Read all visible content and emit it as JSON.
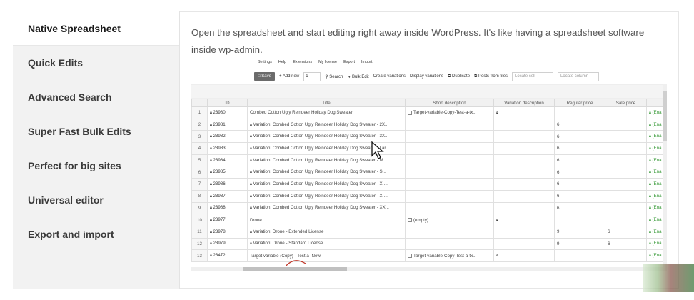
{
  "tabs": [
    {
      "label": "Native Spreadsheet",
      "active": true
    },
    {
      "label": "Quick Edits",
      "active": false
    },
    {
      "label": "Advanced Search",
      "active": false
    },
    {
      "label": "Super Fast Bulk Edits",
      "active": false
    },
    {
      "label": "Perfect for big sites",
      "active": false
    },
    {
      "label": "Universal editor",
      "active": false
    },
    {
      "label": "Export and import",
      "active": false
    }
  ],
  "intro": "Open the spreadsheet and start editing right away inside WordPress. It's like having a spreadsheet software inside wp-admin.",
  "app": {
    "menu": [
      "Settings",
      "Help",
      "Extensions",
      "My license",
      "Export",
      "Import"
    ],
    "toolbar": {
      "save": "Save",
      "add_new": "+ Add new",
      "add_count": "1",
      "search": "Search",
      "bulk_edit": "Bulk Edit",
      "create_variations": "Create variations",
      "display_variations": "Display variations",
      "duplicate": "Duplicate",
      "posts_from_files": "Posts from files",
      "locate_cell": "Locate cell",
      "locate_column": "Locate column"
    },
    "columns": [
      "",
      "ID",
      "Title",
      "Short description",
      "Variation description",
      "Regular price",
      "Sale price",
      ""
    ],
    "rows": [
      {
        "n": "1",
        "id": "23980",
        "title": "Combed Cotton Ugly Reindeer Holiday Dog Sweater",
        "short": "Target-variable-Copy-Test-a-tx...",
        "vdesc": "",
        "regular": "",
        "sale": "",
        "end": "(Ena",
        "title_lock": false,
        "short_check": true,
        "vdesc_lock": true
      },
      {
        "n": "2",
        "id": "23981",
        "title": "Variation: Combed Cotton Ugly Reindeer Holiday Dog Sweater - 2X...",
        "short": "",
        "vdesc": "",
        "regular": "6",
        "sale": "",
        "end": "(Ena",
        "title_lock": true
      },
      {
        "n": "3",
        "id": "23982",
        "title": "Variation: Combed Cotton Ugly Reindeer Holiday Dog Sweater - 3X...",
        "short": "",
        "vdesc": "",
        "regular": "6",
        "sale": "",
        "end": "(Ena",
        "title_lock": true
      },
      {
        "n": "4",
        "id": "23983",
        "title": "Variation: Combed Cotton Ugly Reindeer Holiday Dog Sweater - Lar...",
        "short": "",
        "vdesc": "",
        "regular": "6",
        "sale": "",
        "end": "(Ena",
        "title_lock": true
      },
      {
        "n": "5",
        "id": "23984",
        "title": "Variation: Combed Cotton Ugly Reindeer Holiday Dog Sweater - M...",
        "short": "",
        "vdesc": "",
        "regular": "6",
        "sale": "",
        "end": "(Ena",
        "title_lock": true
      },
      {
        "n": "6",
        "id": "23985",
        "title": "Variation: Combed Cotton Ugly Reindeer Holiday Dog Sweater - S...",
        "short": "",
        "vdesc": "",
        "regular": "6",
        "sale": "",
        "end": "(Ena",
        "title_lock": true
      },
      {
        "n": "7",
        "id": "23986",
        "title": "Variation: Combed Cotton Ugly Reindeer Holiday Dog Sweater - X-...",
        "short": "",
        "vdesc": "",
        "regular": "6",
        "sale": "",
        "end": "(Ena",
        "title_lock": true
      },
      {
        "n": "8",
        "id": "23987",
        "title": "Variation: Combed Cotton Ugly Reindeer Holiday Dog Sweater - X-...",
        "short": "",
        "vdesc": "",
        "regular": "6",
        "sale": "",
        "end": "(Ena",
        "title_lock": true
      },
      {
        "n": "9",
        "id": "23988",
        "title": "Variation: Combed Cotton Ugly Reindeer Holiday Dog Sweater - XX...",
        "short": "",
        "vdesc": "",
        "regular": "6",
        "sale": "",
        "end": "(Ena",
        "title_lock": true
      },
      {
        "n": "10",
        "id": "23977",
        "title": "Drone",
        "short": "(empty)",
        "vdesc": "",
        "regular": "",
        "sale": "",
        "end": "(Ena",
        "title_lock": false,
        "short_check": true,
        "vdesc_lock": true
      },
      {
        "n": "11",
        "id": "23978",
        "title": "Variation: Drone - Extended License",
        "short": "",
        "vdesc": "",
        "regular": "9",
        "sale": "6",
        "end": "(Ena",
        "title_lock": true
      },
      {
        "n": "12",
        "id": "23979",
        "title": "Variation: Drone - Standard License",
        "short": "",
        "vdesc": "",
        "regular": "9",
        "sale": "6",
        "end": "(Ena",
        "title_lock": true
      },
      {
        "n": "13",
        "id": "23472",
        "title": "Target variable (Copy) - Test a- New",
        "short": "Target-variable-Copy-Test-a-tx...",
        "vdesc": "",
        "regular": "",
        "sale": "",
        "end": "(Ena",
        "title_lock": false,
        "short_check": true,
        "vdesc_lock": true
      }
    ]
  }
}
